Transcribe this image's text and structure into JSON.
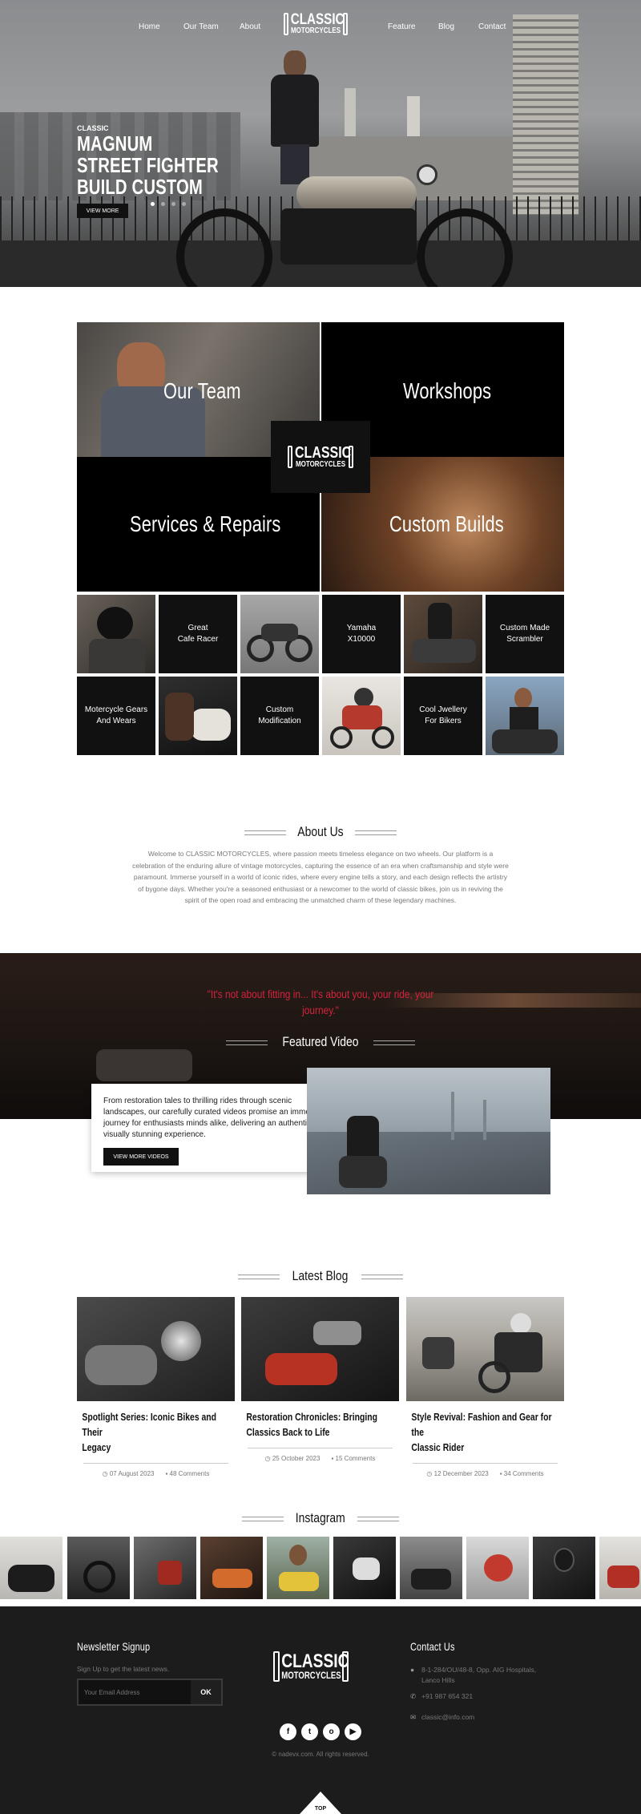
{
  "nav": {
    "left": [
      "Home",
      "Our Team",
      "About"
    ],
    "right": [
      "Feature",
      "Blog",
      "Contact"
    ],
    "logo_top": "CLASSIC",
    "logo_bottom": "MOTORCYCLES"
  },
  "hero": {
    "kicker": "CLASSIC",
    "title_lines": [
      "MAGNUM",
      "STREET FIGHTER",
      "BUILD CUSTOM"
    ],
    "button": "VIEW MORE"
  },
  "categories": {
    "our_team": "Our Team",
    "workshops": "Workshops",
    "services": "Services & Repairs",
    "custom_builds": "Custom Builds"
  },
  "small_tiles": {
    "great_cafe": [
      "Great",
      "Cafe Racer"
    ],
    "yamaha": [
      "Yamaha",
      "X10000"
    ],
    "custom_scrambler": [
      "Custom Made",
      "Scrambler"
    ],
    "gears": [
      "Motercycle Gears",
      "And Wears"
    ],
    "custom_mod": [
      "Custom",
      "Modification"
    ],
    "jewellery": [
      "Cool Jwellery",
      "For Bikers"
    ]
  },
  "about": {
    "title": "About Us",
    "text": "Welcome to CLASSIC MOTORCYCLES, where passion meets timeless elegance on two wheels. Our platform is a celebration of the enduring allure of vintage motorcycles, capturing the essence of an era when craftsmanship and style were paramount. Immerse yourself in a world of iconic rides, where every engine tells a story, and each design reflects the artistry of bygone days. Whether you're a seasoned enthusiast or a newcomer to the world of classic bikes, join us in reviving the spirit of the open road and embracing the unmatched charm of these legendary machines."
  },
  "video": {
    "quote_line1": "\"It's not about fitting in... It's about you, your ride, your",
    "quote_line2": "journey.\"",
    "title": "Featured Video",
    "text": "From restoration tales to thrilling rides through scenic landscapes, our carefully curated videos promise an immersive journey for enthusiasts minds alike, delivering an authentic and visually stunning experience.",
    "button": "VIEW MORE VIDEOS"
  },
  "blog": {
    "title": "Latest Blog",
    "posts": [
      {
        "title_l1": "Spotlight Series: Iconic Bikes and Their",
        "title_l2": "Legacy",
        "date": "07 August 2023",
        "comments": "48 Comments"
      },
      {
        "title_l1": "Restoration Chronicles: Bringing",
        "title_l2": "Classics Back to Life",
        "date": "25 October 2023",
        "comments": "15 Comments"
      },
      {
        "title_l1": "Style Revival: Fashion and Gear for the",
        "title_l2": "Classic Rider",
        "date": "12 December 2023",
        "comments": "34 Comments"
      }
    ]
  },
  "instagram": {
    "title": "Instagram"
  },
  "footer": {
    "newsletter_title": "Newsletter Signup",
    "newsletter_sub": "Sign Up to get the latest news.",
    "email_placeholder": "Your Email Address",
    "ok": "OK",
    "copyright": "© nadevx.com. All rights reserved.",
    "contact_title": "Contact Us",
    "address_l1": "8-1-284/OU/48-8, Opp. AIG Hospitals,",
    "address_l2": "Lanco Hills",
    "phone": "+91 987 654 321",
    "email": "classic@info.com",
    "top": "TOP",
    "social": [
      "f",
      "t",
      "o",
      "▶"
    ]
  }
}
